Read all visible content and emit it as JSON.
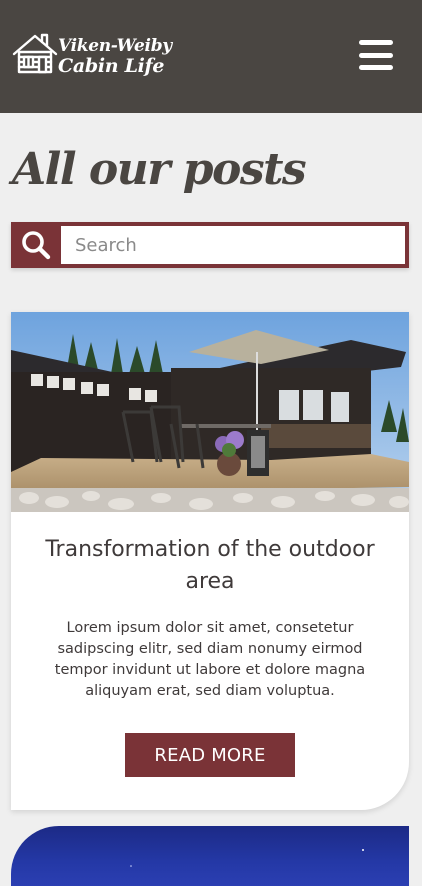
{
  "header": {
    "logo_line1": "Viken-Weiby",
    "logo_line2": "Cabin Life",
    "logo_icon": "cabin-icon",
    "menu_icon": "hamburger-menu-icon"
  },
  "page": {
    "title": "All our posts"
  },
  "search": {
    "placeholder": "Search",
    "value": "",
    "icon": "search-icon"
  },
  "posts": [
    {
      "title": "Transformation of the outdoor area",
      "excerpt": "Lorem ipsum dolor sit amet, consetetur sadipscing elitr, sed diam nonumy eirmod tempor invidunt ut labore et dolore magna aliquyam erat, sed diam voluptua.",
      "button": "READ MORE"
    }
  ],
  "colors": {
    "header_bg": "#4a4642",
    "accent": "#7a3337",
    "page_bg": "#efefef",
    "text": "#3f3a3a"
  }
}
